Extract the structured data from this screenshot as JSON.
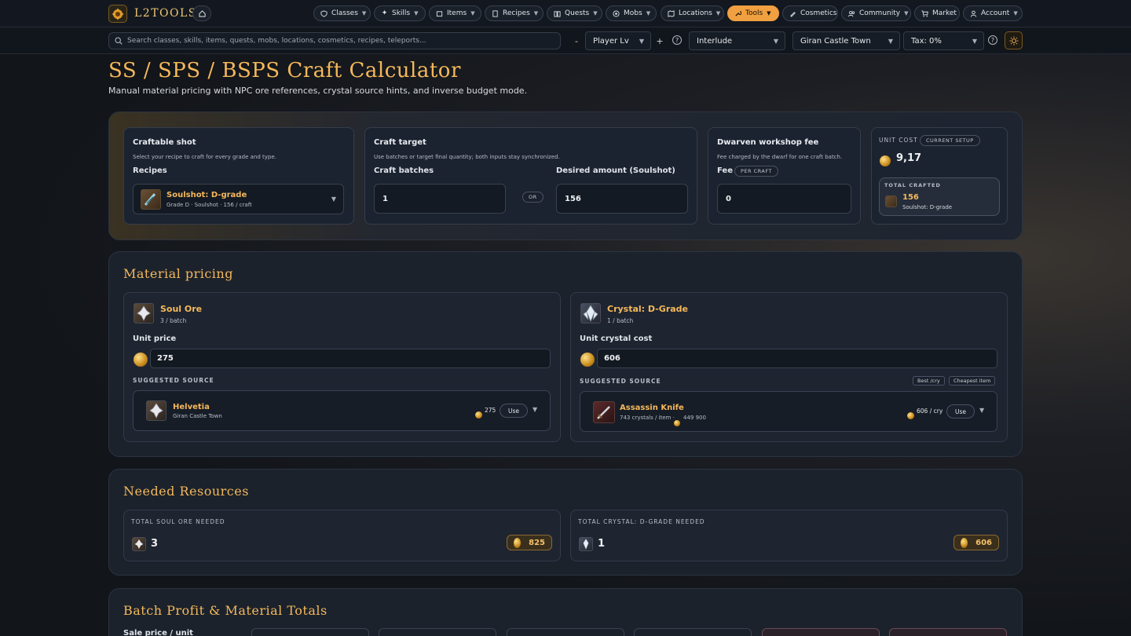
{
  "brand": {
    "name": "L2TOOLS"
  },
  "nav": {
    "items": [
      {
        "label": "Classes",
        "icon": "shield-icon"
      },
      {
        "label": "Skills",
        "icon": "sparkle-icon"
      },
      {
        "label": "Items",
        "icon": "box-icon"
      },
      {
        "label": "Recipes",
        "icon": "scroll-icon"
      },
      {
        "label": "Quests",
        "icon": "book-icon"
      },
      {
        "label": "Mobs",
        "icon": "target-icon"
      },
      {
        "label": "Locations",
        "icon": "map-icon"
      },
      {
        "label": "Tools",
        "icon": "wrench-icon"
      },
      {
        "label": "Cosmetics",
        "icon": "brush-icon"
      },
      {
        "label": "Community",
        "icon": "users-icon"
      },
      {
        "label": "Market",
        "icon": "cart-icon"
      },
      {
        "label": "Account",
        "icon": "user-icon"
      }
    ],
    "active": "Tools"
  },
  "toolbar": {
    "search_placeholder": "Search classes, skills, items, quests, mobs, locations, cosmetics, recipes, teleports...",
    "minus": "-",
    "player_lv": "Player Lv",
    "plus": "+",
    "chronicle": "Interlude",
    "town": "Giran Castle Town",
    "tax": "Tax: 0%",
    "help": "?"
  },
  "page": {
    "title": "SS / SPS / BSPS Craft Calculator",
    "subtitle": "Manual material pricing with NPC ore references, crystal source hints, and inverse budget mode."
  },
  "craft": {
    "craftable": {
      "title": "Craftable shot",
      "desc": "Select your recipe to craft for every grade and type.",
      "recipes_label": "Recipes",
      "recipe_name": "Soulshot: D-grade",
      "recipe_meta": "Grade D · Soulshot · 156 / craft"
    },
    "target": {
      "title": "Craft target",
      "desc": "Use batches or target final quantity; both inputs stay synchronized.",
      "batches_label": "Craft batches",
      "batches_value": "1",
      "or": "OR",
      "desired_label": "Desired amount (Soulshot)",
      "desired_value": "156"
    },
    "fee": {
      "title": "Dwarven workshop fee",
      "desc": "Fee charged by the dwarf for one craft batch.",
      "fee_label": "Fee",
      "per_craft": "PER CRAFT",
      "fee_value": "0"
    },
    "unit": {
      "label": "UNIT COST",
      "badge": "CURRENT SETUP",
      "value": "9,17",
      "total_label": "TOTAL CRAFTED",
      "total_value": "156",
      "total_item": "Soulshot: D-grade"
    }
  },
  "material": {
    "title": "Material pricing",
    "ore": {
      "name": "Soul Ore",
      "qty": "3 / batch",
      "price_label": "Unit price",
      "price": "275",
      "suggested": "SUGGESTED SOURCE",
      "source_name": "Helvetia",
      "source_loc": "Giran Castle Town",
      "source_price": "275",
      "use": "Use"
    },
    "crystal": {
      "name": "Crystal: D-Grade",
      "qty": "1 / batch",
      "price_label": "Unit crystal cost",
      "price": "606",
      "suggested": "SUGGESTED SOURCE",
      "best": "Best /cry",
      "cheapest": "Cheapest item",
      "source_name": "Assassin Knife",
      "source_meta": "743 crystals / item ·",
      "source_meta_price": "449 900",
      "source_price": "606 / cry",
      "use": "Use"
    }
  },
  "needed": {
    "title": "Needed Resources",
    "ore_label": "TOTAL SOUL ORE NEEDED",
    "ore_qty": "3",
    "ore_cost": "825",
    "crystal_label": "TOTAL CRYSTAL: D-GRADE NEEDED",
    "crystal_qty": "1",
    "crystal_cost": "606"
  },
  "batch": {
    "title": "Batch Profit & Material Totals",
    "sale_label": "Sale price / unit"
  }
}
